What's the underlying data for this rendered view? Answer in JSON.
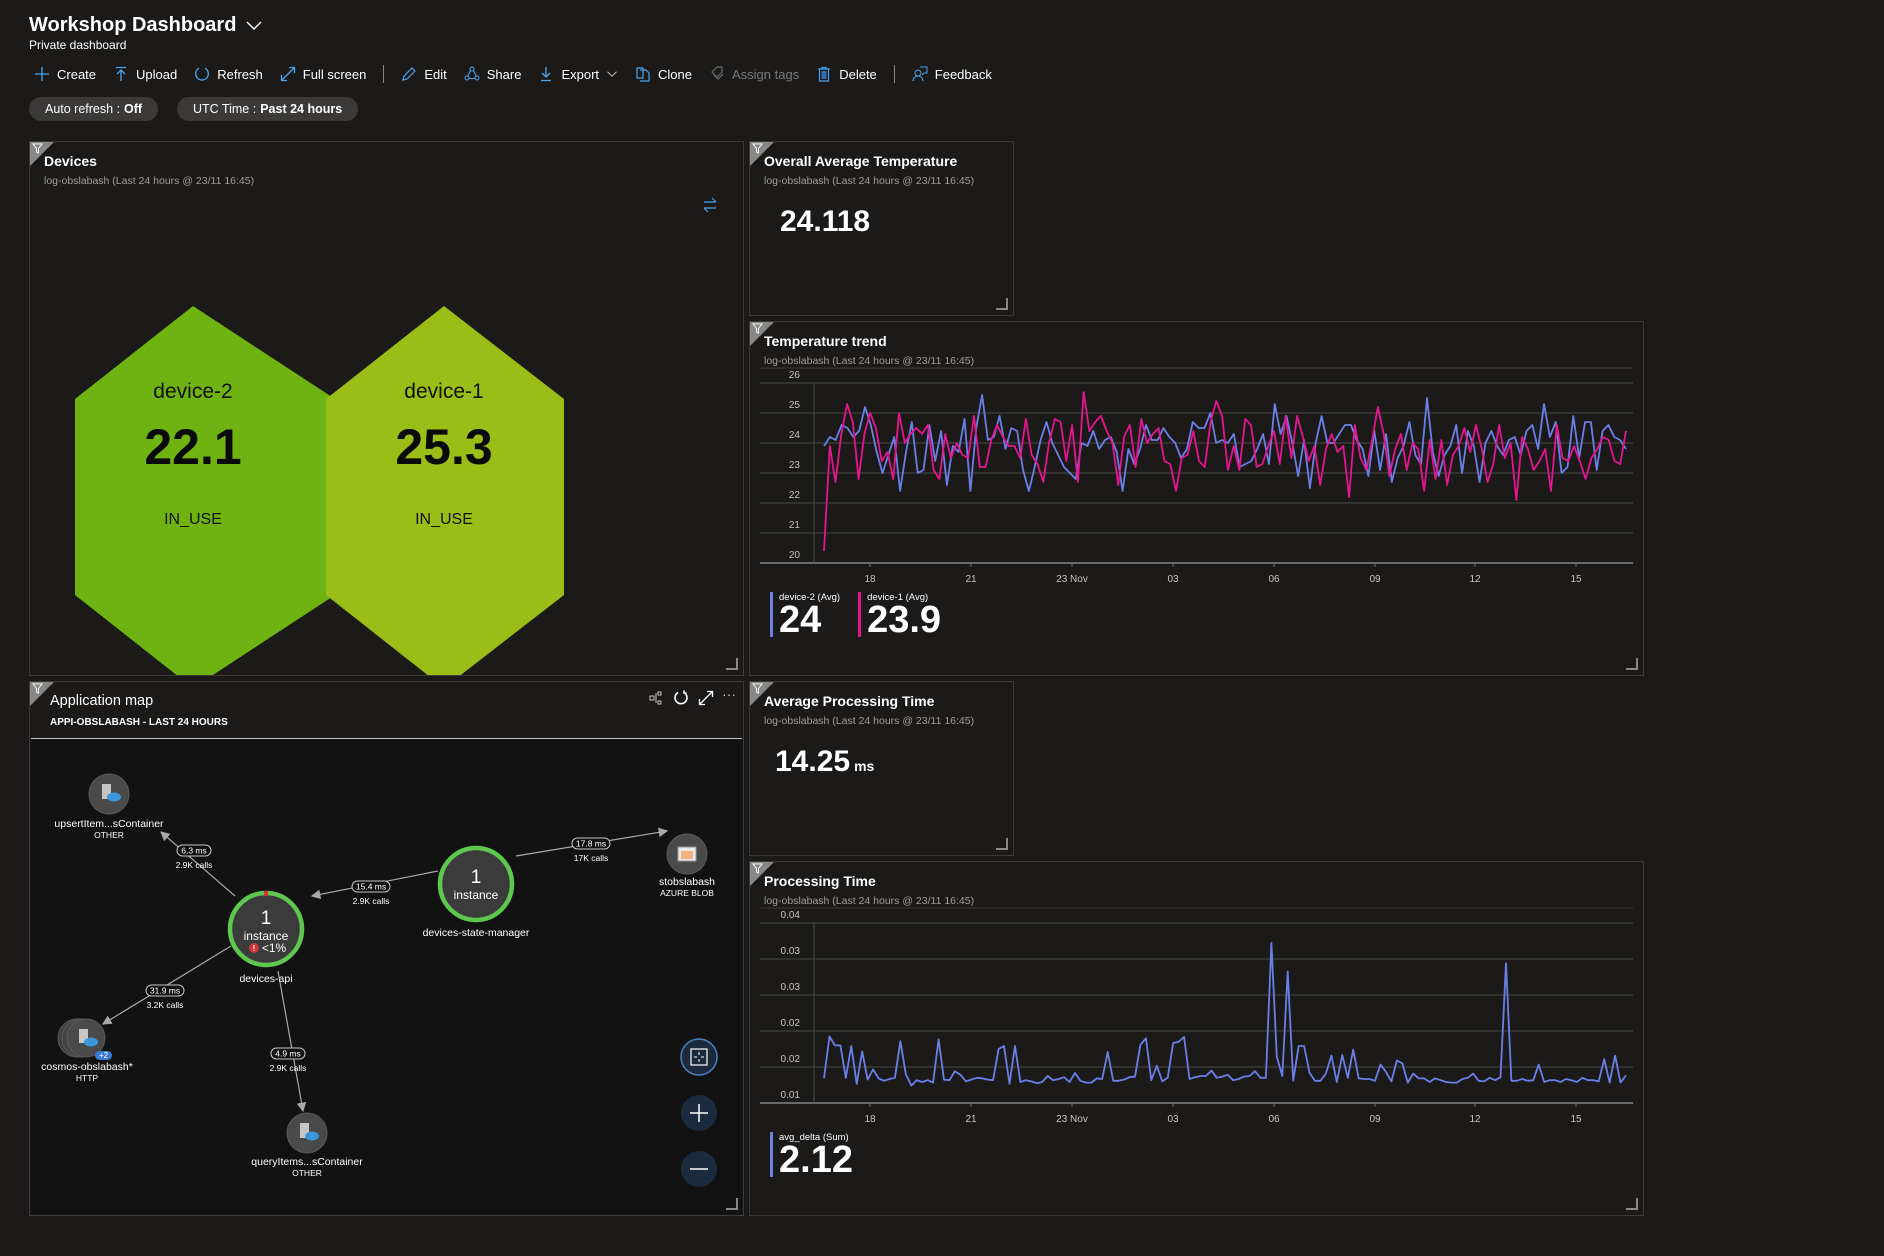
{
  "header": {
    "title": "Workshop Dashboard",
    "subtitle": "Private dashboard"
  },
  "toolbar": {
    "create": "Create",
    "upload": "Upload",
    "refresh": "Refresh",
    "full_screen": "Full screen",
    "edit": "Edit",
    "share": "Share",
    "export": "Export",
    "clone": "Clone",
    "assign_tags": "Assign tags",
    "delete": "Delete",
    "feedback": "Feedback"
  },
  "filters": {
    "auto_refresh_label": "Auto refresh :",
    "auto_refresh_value": "Off",
    "time_label": "UTC Time :",
    "time_value": "Past 24 hours"
  },
  "colors": {
    "device2_hex": "#6fb313",
    "device1_hex": "#9bbd18",
    "series_blue": "#6b7fe8",
    "series_pink": "#e3168f",
    "node_ring": "#5ec84e"
  },
  "devices": {
    "title": "Devices",
    "source": "log-obslabash (Last 24 hours @ 23/11 16:45)",
    "items": [
      {
        "name": "device-2",
        "value": "22.1",
        "status": "IN_USE"
      },
      {
        "name": "device-1",
        "value": "25.3",
        "status": "IN_USE"
      }
    ]
  },
  "overall_avg_temp": {
    "title": "Overall Average Temperature",
    "source": "log-obslabash (Last 24 hours @ 23/11 16:45)",
    "value": "24.118"
  },
  "temp_trend": {
    "title": "Temperature trend",
    "source": "log-obslabash (Last 24 hours @ 23/11 16:45)",
    "legend": [
      {
        "name": "device-2 (Avg)",
        "value": "24"
      },
      {
        "name": "device-1 (Avg)",
        "value": "23.9"
      }
    ]
  },
  "avg_processing": {
    "title": "Average Processing Time",
    "source": "log-obslabash (Last 24 hours @ 23/11 16:45)",
    "value": "14.25",
    "unit": "ms"
  },
  "processing_time": {
    "title": "Processing Time",
    "source": "log-obslabash (Last 24 hours @ 23/11 16:45)",
    "legend": [
      {
        "name": "avg_delta (Sum)",
        "value": "2.12"
      }
    ]
  },
  "app_map": {
    "title": "Application map",
    "subtitle": "APPI-OBSLABASH - LAST 24 HOURS",
    "nodes": {
      "devices_api": {
        "count": "1",
        "unit": "instance",
        "error": "<1%",
        "name": "devices-api"
      },
      "state_manager": {
        "count": "1",
        "unit": "instance",
        "name": "devices-state-manager"
      },
      "upsert": {
        "name": "upsertItem...sContainer",
        "type": "OTHER"
      },
      "query": {
        "name": "queryItems...sContainer",
        "type": "OTHER"
      },
      "cosmos": {
        "name": "cosmos-obslabash*",
        "type": "HTTP",
        "badge": "+2"
      },
      "blob": {
        "name": "stobslabash",
        "type": "AZURE BLOB"
      }
    },
    "edges": {
      "upsert": {
        "ms": "6.3 ms",
        "calls": "2.9K calls"
      },
      "state_to_api": {
        "ms": "15.4 ms",
        "calls": "2.9K calls"
      },
      "state_to_blob": {
        "ms": "17.8 ms",
        "calls": "17K calls"
      },
      "cosmos": {
        "ms": "31.9 ms",
        "calls": "3.2K calls"
      },
      "query": {
        "ms": "4.9 ms",
        "calls": "2.9K calls"
      }
    }
  },
  "chart_data": [
    {
      "type": "line",
      "title": "Temperature trend",
      "xlabel": "",
      "ylabel": "",
      "ylim": [
        20,
        26
      ],
      "yticks": [
        "26",
        "25",
        "24",
        "23",
        "22",
        "21",
        "20"
      ],
      "xticks": [
        "18",
        "21",
        "23 Nov",
        "03",
        "06",
        "09",
        "12",
        "15"
      ],
      "grid": true,
      "legend": "bottom-left",
      "series": [
        {
          "name": "device-2 (Avg)",
          "color": "#6b7fe8",
          "values": [
            23.9,
            24.2,
            24.1,
            24.6,
            24.5,
            24.2,
            24.4,
            25.2,
            24.6,
            23.7,
            23.0,
            23.6,
            24.2,
            22.4,
            23.7,
            24.7,
            23.0,
            23.1,
            24.6,
            23.4,
            24.4,
            22.6,
            23.9,
            23.7,
            24.8,
            22.4,
            24.5,
            25.6,
            24.1,
            24.2,
            24.9,
            23.8,
            24.5,
            24.4,
            23.1,
            22.4,
            23.2,
            24.1,
            24.7,
            24.0,
            23.6,
            23.2,
            23.0,
            22.8,
            24.0,
            23.9,
            24.4,
            23.8,
            24.1,
            24.2,
            23.7,
            22.4,
            23.8,
            23.3,
            23.8,
            24.6,
            24.1,
            24.1,
            24.5,
            24.2,
            24.0,
            23.5,
            23.8,
            24.7,
            24.5,
            24.5,
            25.0,
            24.0,
            24.1,
            24.0,
            24.3,
            23.2,
            23.3,
            23.4,
            23.8,
            24.3,
            23.3,
            25.3,
            24.3,
            24.9,
            24.0,
            22.9,
            24.1,
            22.5,
            24.0,
            24.9,
            24.0,
            24.0,
            24.3,
            24.6,
            24.6,
            24.1,
            23.8,
            22.9,
            24.4,
            23.1,
            24.3,
            22.7,
            23.5,
            23.9,
            24.7,
            23.6,
            23.3,
            25.5,
            23.7,
            22.9,
            23.6,
            23.9,
            24.6,
            23.0,
            24.4,
            23.9,
            22.7,
            24.0,
            24.4,
            23.9,
            23.6,
            24.1,
            24.2,
            23.6,
            24.4,
            24.6,
            23.8,
            25.3,
            24.2,
            24.7,
            23.0,
            23.2,
            24.9,
            23.5,
            24.7,
            24.7,
            23.1,
            24.4,
            24.6,
            24.2,
            24.1,
            23.8
          ]
        },
        {
          "name": "device-1 (Avg)",
          "color": "#e3168f",
          "values": [
            20.4,
            23.9,
            22.7,
            24.3,
            25.3,
            24.7,
            22.8,
            24.3,
            25.0,
            24.5,
            23.4,
            23.7,
            22.8,
            25.0,
            24.0,
            24.3,
            24.5,
            24.3,
            24.6,
            23.1,
            22.8,
            24.3,
            23.5,
            24.0,
            23.6,
            23.5,
            24.9,
            23.2,
            23.2,
            24.1,
            24.6,
            24.2,
            23.9,
            23.9,
            23.5,
            24.8,
            23.6,
            23.3,
            22.7,
            24.0,
            24.8,
            24.7,
            23.4,
            24.6,
            22.7,
            25.7,
            24.4,
            24.7,
            24.9,
            24.4,
            24.0,
            22.6,
            24.2,
            24.6,
            23.2,
            24.8,
            24.0,
            24.3,
            24.5,
            23.4,
            23.3,
            22.4,
            23.5,
            23.6,
            24.4,
            23.4,
            23.2,
            24.7,
            25.4,
            24.9,
            23.1,
            23.9,
            23.1,
            24.8,
            24.6,
            23.2,
            23.3,
            23.9,
            24.4,
            23.3,
            24.9,
            23.5,
            24.9,
            24.2,
            23.4,
            23.9,
            22.6,
            23.8,
            24.3,
            23.7,
            23.9,
            22.2,
            24.6,
            23.5,
            23.1,
            24.1,
            25.2,
            24.3,
            22.9,
            23.8,
            24.3,
            23.1,
            24.0,
            23.8,
            22.4,
            24.1,
            22.8,
            24.1,
            22.6,
            23.6,
            23.9,
            24.5,
            23.7,
            24.6,
            23.8,
            22.7,
            23.3,
            24.6,
            23.5,
            24.0,
            22.1,
            24.2,
            23.8,
            23.1,
            23.4,
            23.8,
            22.4,
            24.6,
            23.5,
            23.4,
            23.9,
            23.4,
            22.8,
            23.5,
            23.8,
            24.2,
            24.1,
            23.4,
            23.3,
            24.4
          ]
        }
      ]
    },
    {
      "type": "line",
      "title": "Processing Time",
      "xlabel": "",
      "ylabel": "",
      "ylim": [
        0.01,
        0.04
      ],
      "yticks": [
        "0.04",
        "0.03",
        "0.03",
        "0.02",
        "0.02",
        "0.01"
      ],
      "xticks": [
        "18",
        "21",
        "23 Nov",
        "03",
        "06",
        "09",
        "12",
        "15"
      ],
      "grid": true,
      "legend": "bottom-left",
      "series": [
        {
          "name": "avg_delta (Sum)",
          "color": "#6b7fe8",
          "values": [
            0.0141,
            0.0211,
            0.0196,
            0.0196,
            0.0142,
            0.0195,
            0.0132,
            0.0186,
            0.0139,
            0.0156,
            0.0141,
            0.0137,
            0.014,
            0.0142,
            0.0203,
            0.0148,
            0.0129,
            0.0138,
            0.0135,
            0.0138,
            0.0134,
            0.0206,
            0.0139,
            0.0138,
            0.0153,
            0.0147,
            0.0136,
            0.0139,
            0.0142,
            0.0141,
            0.0139,
            0.0138,
            0.019,
            0.0195,
            0.0132,
            0.0195,
            0.0135,
            0.0138,
            0.0136,
            0.0133,
            0.0135,
            0.0145,
            0.0138,
            0.014,
            0.0143,
            0.0135,
            0.015,
            0.0137,
            0.0134,
            0.0134,
            0.0141,
            0.014,
            0.0185,
            0.0137,
            0.0137,
            0.0139,
            0.0143,
            0.0144,
            0.0197,
            0.0208,
            0.0138,
            0.0162,
            0.0136,
            0.0142,
            0.02,
            0.0202,
            0.021,
            0.014,
            0.0143,
            0.0145,
            0.0145,
            0.0154,
            0.0142,
            0.0144,
            0.0147,
            0.0138,
            0.014,
            0.0144,
            0.0145,
            0.0153,
            0.0142,
            0.0142,
            0.0367,
            0.0177,
            0.0145,
            0.0319,
            0.0137,
            0.0195,
            0.0195,
            0.015,
            0.0137,
            0.0137,
            0.0149,
            0.0179,
            0.0135,
            0.018,
            0.0142,
            0.0189,
            0.0141,
            0.014,
            0.014,
            0.0137,
            0.0164,
            0.0152,
            0.0136,
            0.0171,
            0.0166,
            0.0134,
            0.0149,
            0.0141,
            0.0141,
            0.0135,
            0.0141,
            0.0138,
            0.0135,
            0.0134,
            0.0134,
            0.014,
            0.0142,
            0.0149,
            0.0137,
            0.0136,
            0.0142,
            0.0138,
            0.0143,
            0.0333,
            0.0137,
            0.0137,
            0.014,
            0.0137,
            0.0138,
            0.0164,
            0.0135,
            0.0138,
            0.0138,
            0.0135,
            0.014,
            0.0138,
            0.0135,
            0.0142,
            0.0138,
            0.0138,
            0.0136,
            0.0173,
            0.0134,
            0.0179,
            0.0134,
            0.0146
          ]
        }
      ]
    }
  ]
}
